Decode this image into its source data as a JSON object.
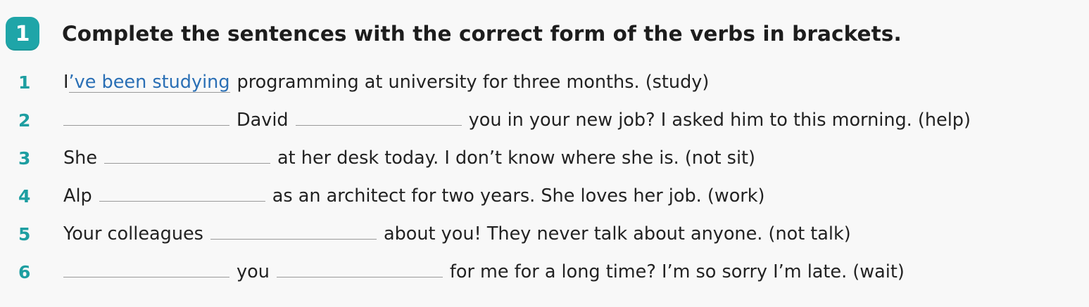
{
  "exercise": {
    "number": "1",
    "instruction": "Complete the sentences with the correct form of the verbs in brackets."
  },
  "items": [
    {
      "num": "1",
      "start": "I",
      "answer": "’ve been studying",
      "after_answer": "programming at university for three months. (study)"
    },
    {
      "num": "2",
      "middle": "David",
      "end": "you in your new job? I asked him to this morning. (help)"
    },
    {
      "num": "3",
      "start": "She",
      "end": "at her desk today. I don’t know where she is. (not sit)"
    },
    {
      "num": "4",
      "start": "Alp",
      "end": "as an architect for two years. She loves her job. (work)"
    },
    {
      "num": "5",
      "start": "Your colleagues",
      "end": "about you! They never talk about anyone. (not talk)"
    },
    {
      "num": "6",
      "middle": "you",
      "end": "for me for a long time? I’m so sorry I’m late. (wait)"
    }
  ]
}
